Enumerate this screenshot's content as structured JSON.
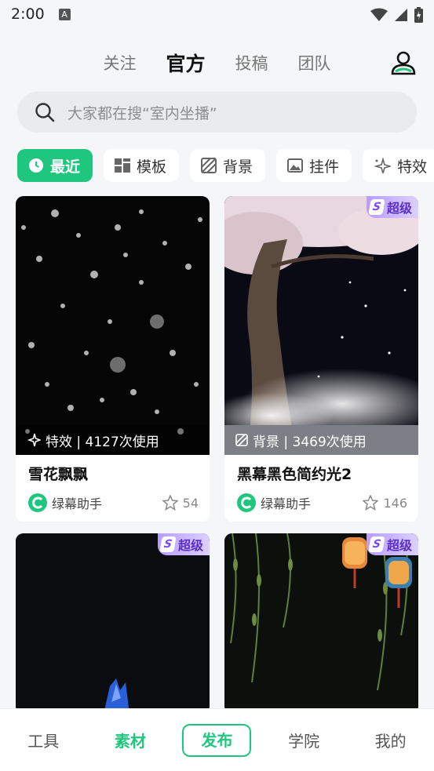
{
  "status_bar": {
    "time": "2:00"
  },
  "top_tabs": [
    {
      "label": "关注"
    },
    {
      "label": "官方",
      "active": true
    },
    {
      "label": "投稿"
    },
    {
      "label": "团队"
    }
  ],
  "search": {
    "placeholder": "大家都在搜“室内坐播”"
  },
  "chips": [
    {
      "label": "最近",
      "icon": "clock-icon",
      "active": true
    },
    {
      "label": "模板",
      "icon": "template-icon"
    },
    {
      "label": "背景",
      "icon": "background-icon"
    },
    {
      "label": "挂件",
      "icon": "image-icon"
    },
    {
      "label": "特效",
      "icon": "sparkle-icon"
    }
  ],
  "cards": [
    {
      "overlay": "特效 | 4127次使用",
      "title": "雪花飘飘",
      "author": "绿幕助手",
      "likes": "54",
      "badge": ""
    },
    {
      "overlay": "背景 | 3469次使用",
      "title": "黑幕黑色简约光2",
      "author": "绿幕助手",
      "likes": "146",
      "badge": "超级"
    },
    {
      "overlay": "",
      "title": "",
      "author": "",
      "likes": "",
      "badge": "超级"
    },
    {
      "overlay": "",
      "title": "",
      "author": "",
      "likes": "",
      "badge": "超级"
    }
  ],
  "bottom_nav": [
    {
      "label": "工具"
    },
    {
      "label": "素材",
      "active": true
    },
    {
      "label": "发布"
    },
    {
      "label": "学院"
    },
    {
      "label": "我的"
    }
  ],
  "colors": {
    "accent": "#1fc77e",
    "badge": "#7a4cf0"
  }
}
